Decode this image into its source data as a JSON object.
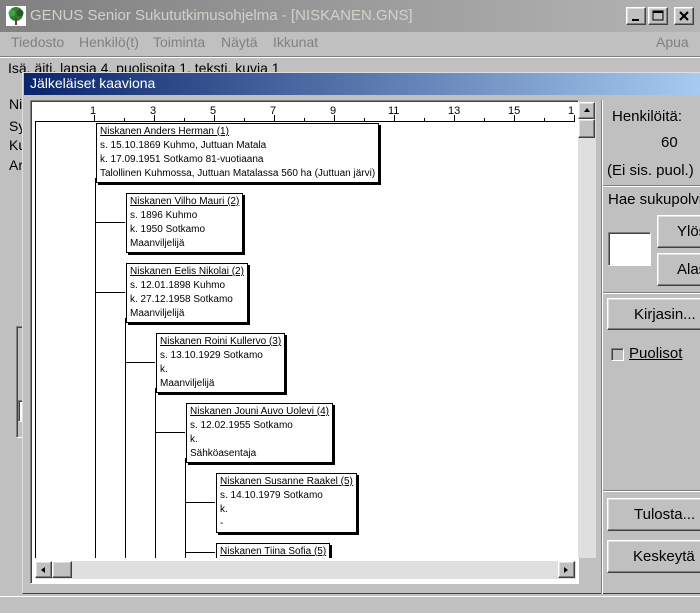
{
  "main_window": {
    "title": "GENUS Senior  Sukututkimusohjelma - [NISKANEN.GNS]",
    "menu": [
      "Tiedosto",
      "Henkilö(t)",
      "Toiminta",
      "Näytä",
      "Ikkunat"
    ],
    "help": "Apua",
    "info_line": "Isä, äiti, lapsia 4, puolisoita 1, teksti, kuvia 1",
    "left_fragments": [
      "Ni",
      "Sy",
      "Ku",
      "Ar"
    ]
  },
  "dialog": {
    "title": "Jälkeläiset kaaviona",
    "ruler": [
      "1",
      "3",
      "5",
      "7",
      "9",
      "11",
      "13",
      "15",
      "1"
    ],
    "people": [
      {
        "name": "Niskanen Anders Herman (1)",
        "lines": [
          "s. 15.10.1869 Kuhmo, Juttuan Matala",
          "k. 17.09.1951 Sotkamo 81-vuotiaana",
          "Talollinen Kuhmossa, Juttuan Matalassa 560 ha (Juttuan järvi)"
        ]
      },
      {
        "name": "Niskanen Vilho Mauri (2)",
        "lines": [
          "s. 1896 Kuhmo",
          "k. 1950 Sotkamo",
          "Maanviljelijä"
        ]
      },
      {
        "name": "Niskanen Eelis Nikolai (2)",
        "lines": [
          "s. 12.01.1898 Kuhmo",
          "k. 27.12.1958 Sotkamo",
          "Maanviljelijä"
        ]
      },
      {
        "name": "Niskanen Roini Kullervo (3)",
        "lines": [
          "s. 13.10.1929 Sotkamo",
          "k.",
          "Maanviljelijä"
        ]
      },
      {
        "name": "Niskanen Jouni Auvo Uolevi (4)",
        "lines": [
          "s. 12.02.1955 Sotkamo",
          "k.",
          "Sähköasentaja"
        ]
      },
      {
        "name": "Niskanen Susanne Raakel (5)",
        "lines": [
          "s. 14.10.1979 Sotkamo",
          "k.",
          "-"
        ]
      },
      {
        "name": "Niskanen Tiina Sofia (5)",
        "lines": []
      }
    ]
  },
  "right_panel": {
    "persons_label": "Henkilöitä:",
    "persons_count": "60",
    "excl_note": "(Ei sis. puol.)",
    "search_label": "Hae sukupolvi",
    "up_button": "Ylös",
    "down_button": "Alas",
    "font_button": "Kirjasin...",
    "spouses_label": "Puolisot",
    "spouses_checked": false,
    "print_button": "Tulosta...",
    "cancel_button": "Keskeytä"
  },
  "colors": {
    "dialog_title_start": "#0a246a",
    "dialog_title_end": "#a6caf0",
    "face": "#c0c0c0"
  }
}
